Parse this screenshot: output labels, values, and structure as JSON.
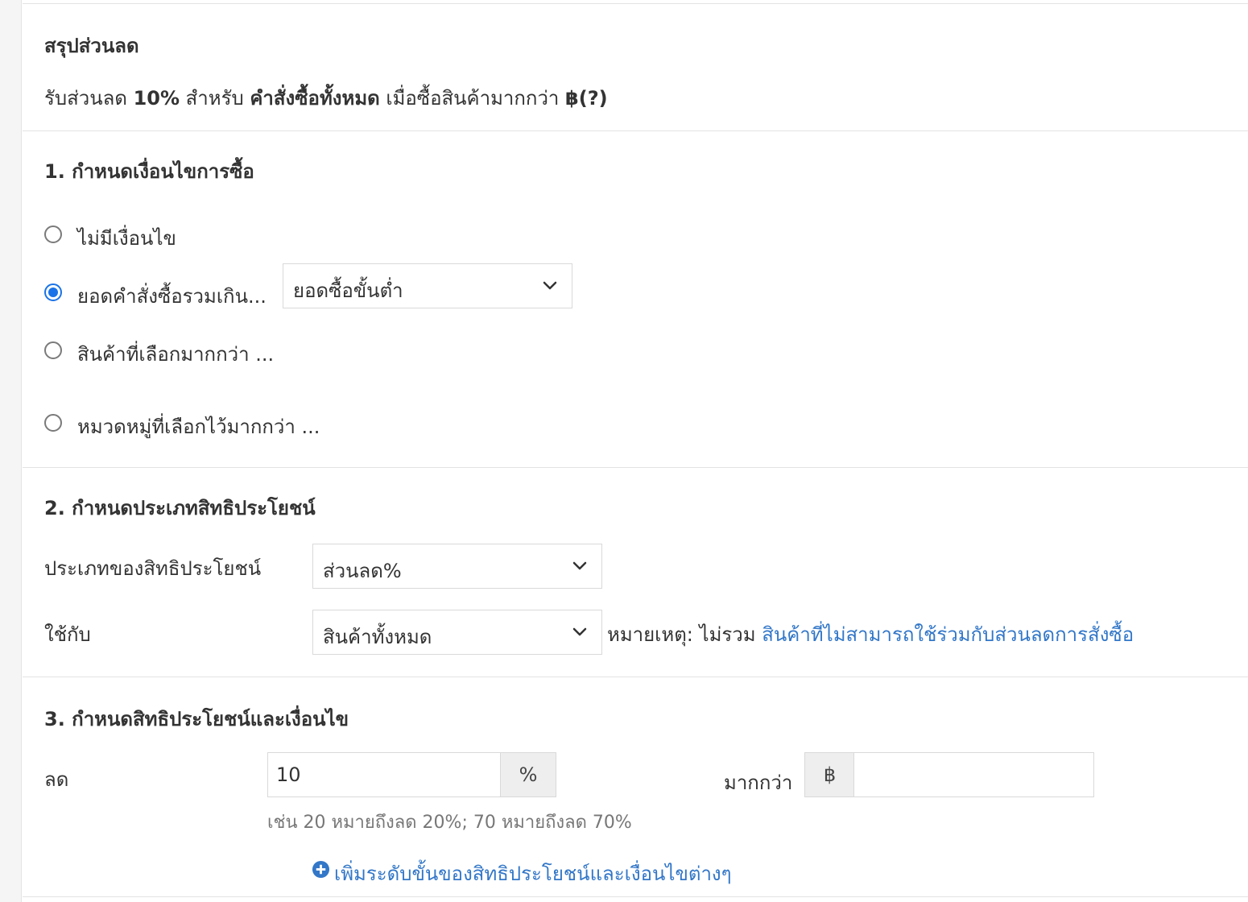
{
  "summary": {
    "title": "สรุปส่วนลด",
    "line_part1": "รับส่วนลด ",
    "line_discount": "10%",
    "line_part2": " สำหรับ ",
    "line_scope": "คำสั่งซื้อทั้งหมด",
    "line_part3": " เมื่อซื้อสินค้ามากกว่า ",
    "line_amount": "฿(?)"
  },
  "section1": {
    "title": "1. กำหนดเงื่อนไขการซื้อ",
    "options": [
      {
        "label": "ไม่มีเงื่อนไข",
        "checked": false
      },
      {
        "label": "ยอดคำสั่งซื้อรวมเกิน...",
        "checked": true
      },
      {
        "label": "สินค้าที่เลือกมากกว่า ...",
        "checked": false
      },
      {
        "label": "หมวดหมู่ที่เลือกไว้มากกว่า ...",
        "checked": false
      }
    ],
    "condition_select": "ยอดซื้อขั้นต่ำ"
  },
  "section2": {
    "title": "2. กำหนดประเภทสิทธิประโยชน์",
    "benefit_type_label": "ประเภทของสิทธิประโยชน์",
    "benefit_type_value": "ส่วนลด%",
    "apply_to_label": "ใช้กับ",
    "apply_to_value": "สินค้าทั้งหมด",
    "note_prefix": "หมายเหตุ: ไม่รวม ",
    "note_link": "สินค้าที่ไม่สามารถใช้ร่วมกับส่วนลดการสั่งซื้อ"
  },
  "section3": {
    "title": "3. กำหนดสิทธิประโยชน์และเงื่อนไข",
    "discount_label": "ลด",
    "discount_value": "10",
    "discount_unit": "%",
    "more_than_label": "มากกว่า",
    "currency_symbol": "฿",
    "amount_value": "",
    "hint": "เช่น 20 หมายถึงลด 20%; 70 หมายถึงลด 70%",
    "add_tier_label": "เพิ่มระดับขั้นของสิทธิประโยชน์และเงื่อนไขต่างๆ"
  },
  "colors": {
    "accent": "#1a73e8",
    "link": "#3277c8",
    "border": "#d9d9d9",
    "addon_bg": "#eeeeee"
  },
  "icons": {
    "chevron": "chevron-down-icon",
    "add": "plus-circle-icon"
  }
}
